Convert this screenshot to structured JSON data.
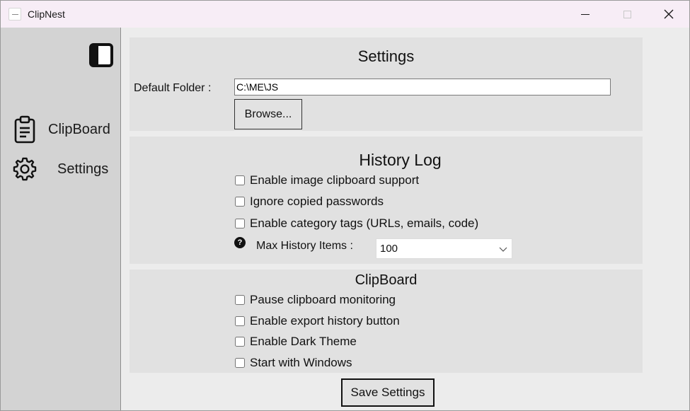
{
  "window": {
    "title": "ClipNest"
  },
  "sidebar": {
    "items": [
      {
        "label": "ClipBoard",
        "icon": "clipboard-icon"
      },
      {
        "label": "Settings",
        "icon": "gear-icon"
      }
    ]
  },
  "settings": {
    "title": "Settings",
    "folder_label": "Default Folder :",
    "folder_value": "C:\\ME\\JS",
    "browse_label": "Browse..."
  },
  "history": {
    "title": "History Log",
    "options": [
      {
        "label": "Enable image clipboard support",
        "checked": false
      },
      {
        "label": "Ignore copied passwords",
        "checked": false
      },
      {
        "label": "Enable category tags (URLs, emails, code)",
        "checked": false
      }
    ],
    "help_glyph": "?",
    "max_items_label": "Max History Items :",
    "max_items_value": "100"
  },
  "clipboard": {
    "title": "ClipBoard",
    "options": [
      {
        "label": "Pause clipboard monitoring",
        "checked": false
      },
      {
        "label": "Enable export history button",
        "checked": false
      },
      {
        "label": "Enable Dark Theme",
        "checked": false
      },
      {
        "label": "Start with Windows",
        "checked": false
      }
    ]
  },
  "save_label": "Save Settings",
  "colors": {
    "titlebar": "#f7edf6",
    "sidebar": "#d3d3d3",
    "panel": "#e1e1e1",
    "background": "#ececec"
  }
}
